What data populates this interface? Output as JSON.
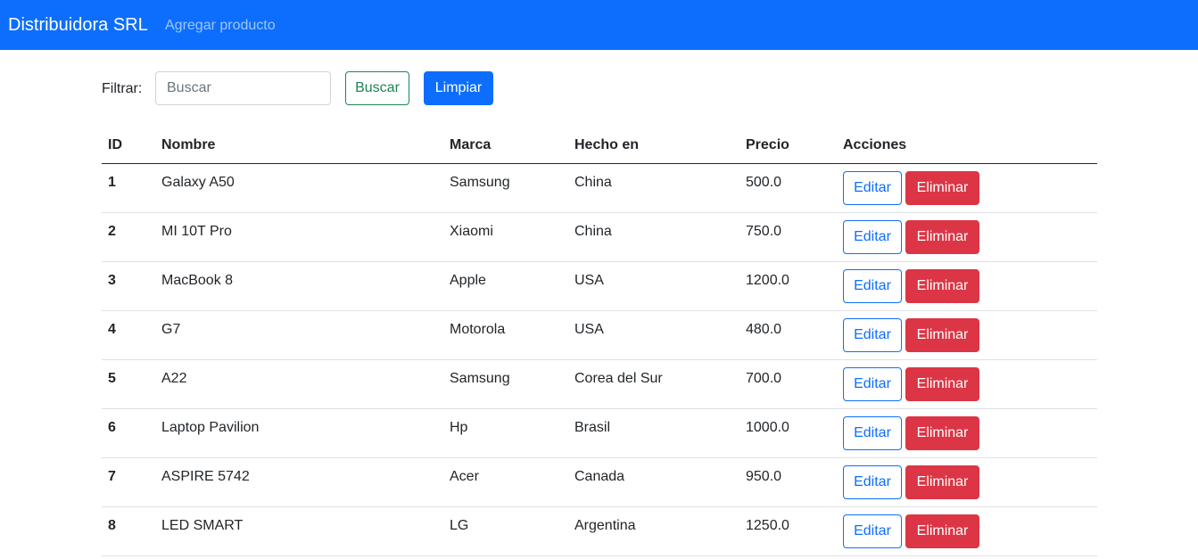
{
  "navbar": {
    "brand": "Distribuidora SRL",
    "link": "Agregar producto"
  },
  "filter": {
    "label": "Filtrar:",
    "placeholder": "Buscar",
    "search_button": "Buscar",
    "clear_button": "Limpiar"
  },
  "table": {
    "headers": [
      "ID",
      "Nombre",
      "Marca",
      "Hecho en",
      "Precio",
      "Acciones"
    ],
    "edit_label": "Editar",
    "delete_label": "Eliminar",
    "rows": [
      {
        "id": "1",
        "nombre": "Galaxy A50",
        "marca": "Samsung",
        "hecho_en": "China",
        "precio": "500.0"
      },
      {
        "id": "2",
        "nombre": "MI 10T Pro",
        "marca": "Xiaomi",
        "hecho_en": "China",
        "precio": "750.0"
      },
      {
        "id": "3",
        "nombre": "MacBook 8",
        "marca": "Apple",
        "hecho_en": "USA",
        "precio": "1200.0"
      },
      {
        "id": "4",
        "nombre": "G7",
        "marca": "Motorola",
        "hecho_en": "USA",
        "precio": "480.0"
      },
      {
        "id": "5",
        "nombre": "A22",
        "marca": "Samsung",
        "hecho_en": "Corea del Sur",
        "precio": "700.0"
      },
      {
        "id": "6",
        "nombre": "Laptop Pavilion",
        "marca": "Hp",
        "hecho_en": "Brasil",
        "precio": "1000.0"
      },
      {
        "id": "7",
        "nombre": "ASPIRE 5742",
        "marca": "Acer",
        "hecho_en": "Canada",
        "precio": "950.0"
      },
      {
        "id": "8",
        "nombre": "LED SMART",
        "marca": "LG",
        "hecho_en": "Argentina",
        "precio": "1250.0"
      }
    ]
  },
  "colors": {
    "primary": "#0d6efd",
    "success": "#198754",
    "danger": "#dc3545"
  }
}
